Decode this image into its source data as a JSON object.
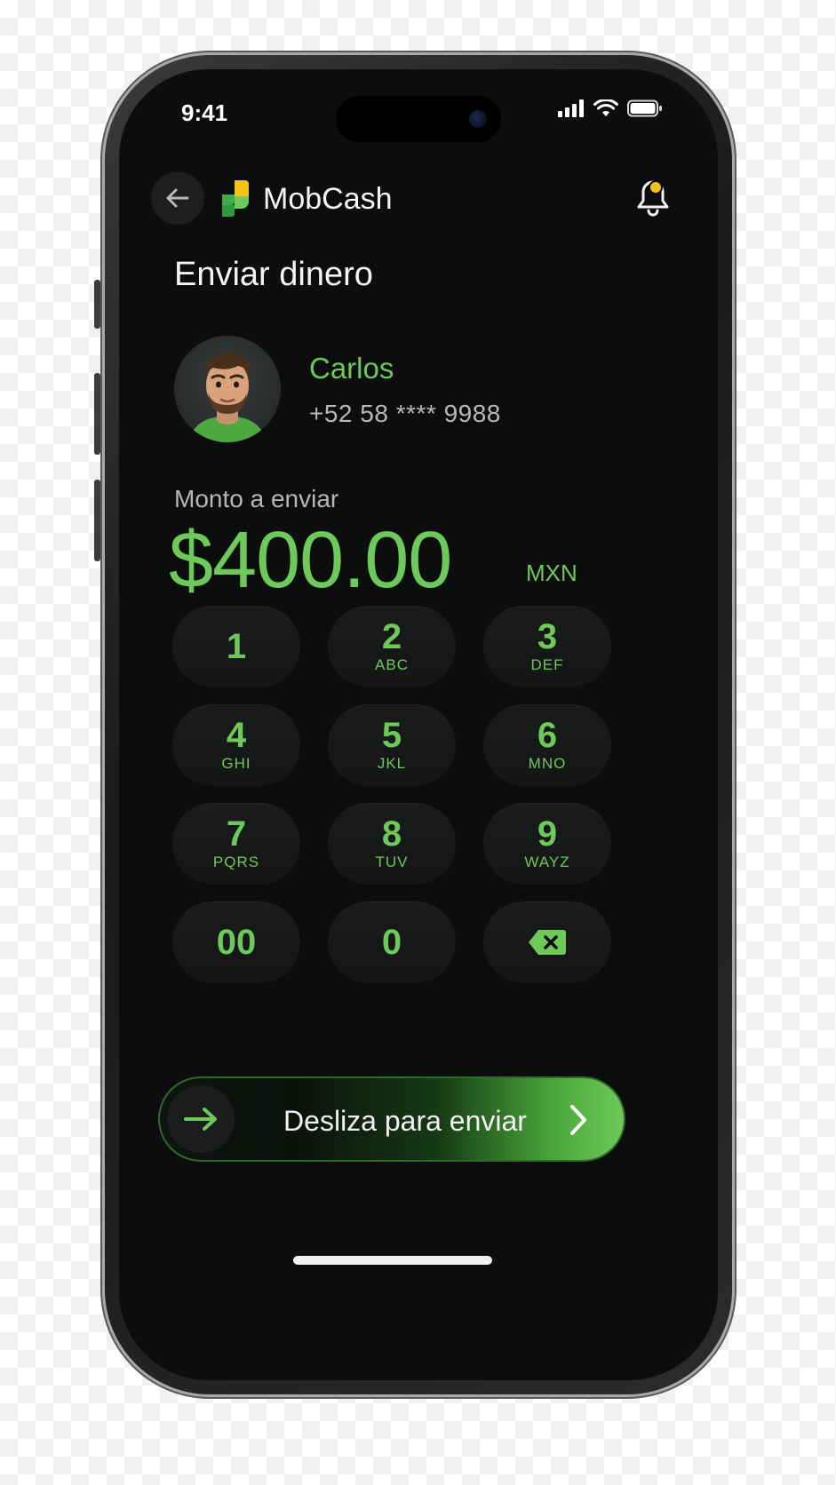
{
  "status_bar": {
    "time": "9:41",
    "icons": [
      "signal-icon",
      "wifi-icon",
      "battery-icon"
    ]
  },
  "header": {
    "app_name": "MobCash",
    "back_icon": "arrow-left-icon",
    "logo_icon": "mobcash-logo-icon",
    "notification_icon": "bell-icon",
    "notification_dot_color": "#f4c21b"
  },
  "page": {
    "title": "Enviar dinero"
  },
  "contact": {
    "name": "Carlos",
    "phone": "+52 58 **** 9988"
  },
  "amount": {
    "label": "Monto a enviar",
    "value": "$400.00",
    "currency": "MXN"
  },
  "keypad": {
    "keys": [
      {
        "digit": "1",
        "letters": ""
      },
      {
        "digit": "2",
        "letters": "ABC"
      },
      {
        "digit": "3",
        "letters": "DEF"
      },
      {
        "digit": "4",
        "letters": "GHI"
      },
      {
        "digit": "5",
        "letters": "JKL"
      },
      {
        "digit": "6",
        "letters": "MNO"
      },
      {
        "digit": "7",
        "letters": "PQRS"
      },
      {
        "digit": "8",
        "letters": "TUV"
      },
      {
        "digit": "9",
        "letters": "WAYZ"
      },
      {
        "digit": "00",
        "letters": ""
      },
      {
        "digit": "0",
        "letters": ""
      }
    ],
    "delete_icon": "backspace-icon"
  },
  "slide_to_send": {
    "label": "Desliza para enviar",
    "knob_icon": "arrow-right-icon",
    "end_icon": "chevron-right-icon"
  },
  "colors": {
    "accent": "#6cc95a",
    "background": "#0c0d0d",
    "key_background": "#171919"
  }
}
